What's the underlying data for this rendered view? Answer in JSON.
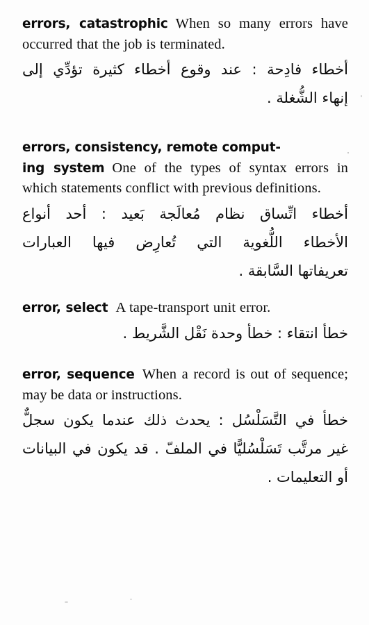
{
  "page": {
    "type": "scanned-dictionary-page",
    "language_pair": "English-Arabic",
    "background_color": "#fdfdfd",
    "text_color": "#0b0b0b"
  },
  "entries": [
    {
      "headword": "errors, catastrophic",
      "definition_en": "When so many errors have occurred that the job is terminated.",
      "definition_ar_lines": [
        "أخطاء فادِحة : عند وقوع أخطاء كثيرة تؤدِّي إلى",
        "إنهاء الشُّغلة ."
      ]
    },
    {
      "headword": "errors, consistency, remote comput-ing system",
      "headword_line_1": "errors, consistency, remote comput-",
      "headword_line_2": "ing system",
      "definition_en": "One of the types of syntax errors in which statements conflict with previous definitions.",
      "definition_ar_lines": [
        "أخطاء اتِّساق نظام مُعالَجة بَعيد : أحد أنواع",
        "الأخطاء اللُّغوية التي تُعارِض فيها العبارات",
        "تعريفاتها السَّابقة ."
      ]
    },
    {
      "headword": "error, select",
      "definition_en": "A tape-transport unit error.",
      "definition_ar_lines": [
        "خطأ انتقاء : خطأ وحدة نَقْل الشَّريط ."
      ]
    },
    {
      "headword": "error, sequence",
      "definition_en": "When a record is out of sequence; may be data or instructions.",
      "definition_ar_lines": [
        "خطأ في التَّسَلْسُل : يحدث ذلك عندما يكون سجلٌّ",
        "غير مرتَّب تَسَلْسُليًّا في الملفّ . قد يكون في البيانات",
        "أو التعليمات ."
      ]
    }
  ]
}
